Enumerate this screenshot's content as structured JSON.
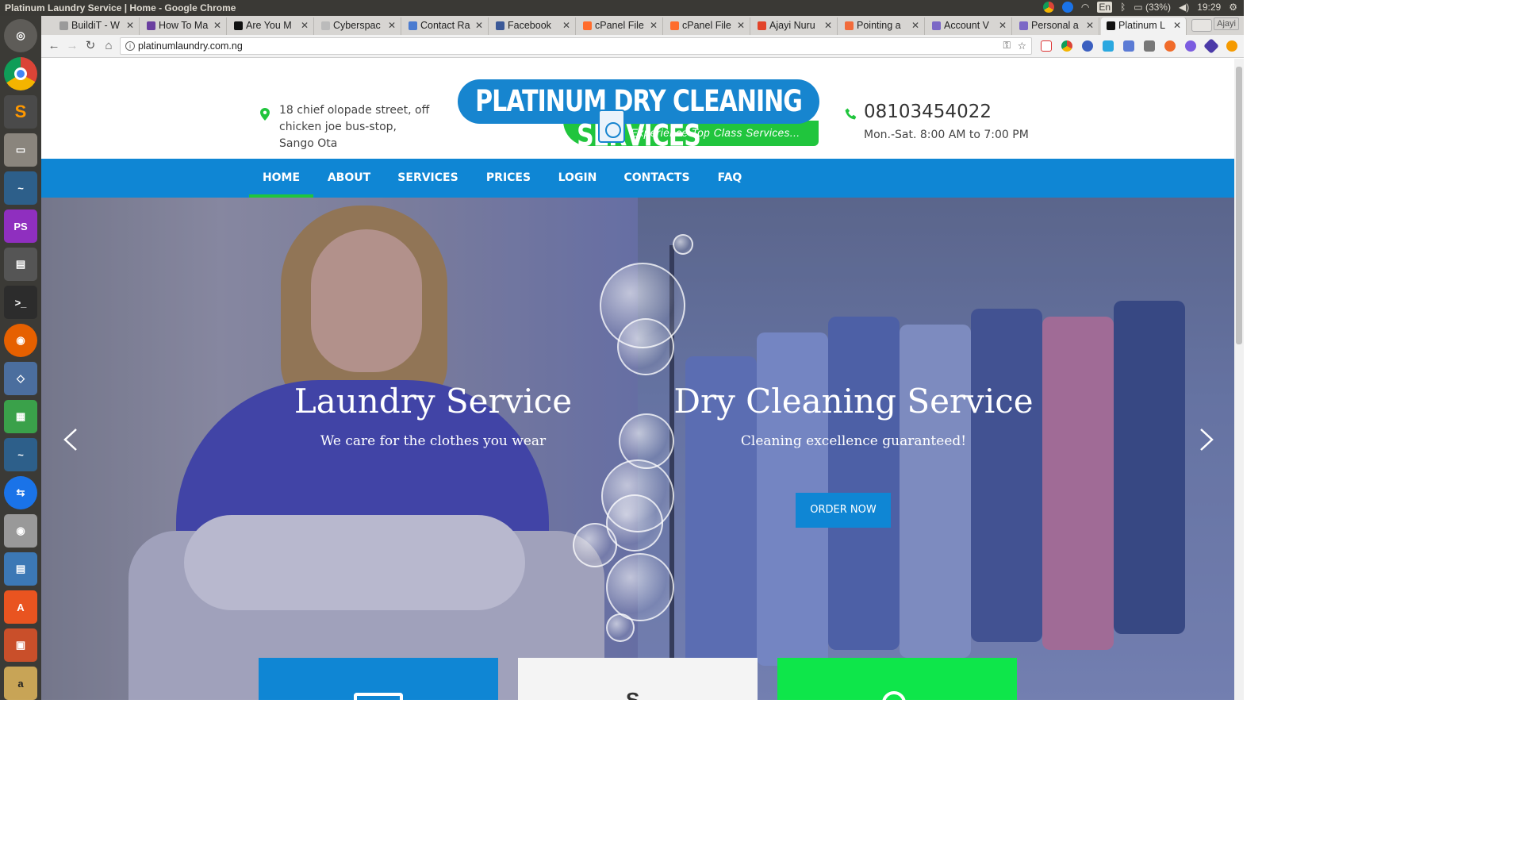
{
  "os": {
    "window_title": "Platinum Laundry Service | Home - Google Chrome",
    "battery": "(33%)",
    "clock": "19:29",
    "keyboard": "En"
  },
  "tabs": [
    {
      "label": "BuildiT - W",
      "fav": "#9a9a9a"
    },
    {
      "label": "How To Ma",
      "fav": "#6a3fa0"
    },
    {
      "label": "Are You M",
      "fav": "#111111"
    },
    {
      "label": "Cyberspac",
      "fav": "#bbbbbb"
    },
    {
      "label": "Contact Ra",
      "fav": "#4a7bd0"
    },
    {
      "label": "Facebook",
      "fav": "#3b5998"
    },
    {
      "label": "cPanel File",
      "fav": "#ff6c2c"
    },
    {
      "label": "cPanel File",
      "fav": "#ff6c2c"
    },
    {
      "label": "Ajayi Nuru",
      "fav": "#e24329"
    },
    {
      "label": "Pointing a",
      "fav": "#f26b3a"
    },
    {
      "label": "Account V",
      "fav": "#7b68c6"
    },
    {
      "label": "Personal a",
      "fav": "#7b68c6"
    },
    {
      "label": "Platinum L",
      "fav": "#111111"
    }
  ],
  "browser": {
    "url": "platinumlaundry.com.ng",
    "profile": "Ajayi"
  },
  "site": {
    "address": "18 chief olopade street, off chicken joe bus-stop, Sango Ota",
    "logo_name": "PLATINUM DRY CLEANING SERVICES",
    "logo_tagline": "Experience Top Class Services...",
    "phone": "08103454022",
    "hours": "Mon.-Sat. 8:00 AM to 7:00 PM",
    "nav": [
      "HOME",
      "ABOUT",
      "SERVICES",
      "PRICES",
      "LOGIN",
      "CONTACTS",
      "FAQ"
    ],
    "colors": {
      "brand_blue": "#0f86d4",
      "brand_green": "#20c53d"
    }
  },
  "hero": {
    "slide1_title": "Laundry Service",
    "slide1_sub": "We care for the clothes you wear",
    "slide2_title": "Dry Cleaning Service",
    "slide2_sub": "Cleaning excellence guaranteed!",
    "order_button": "ORDER NOW"
  },
  "features": [
    {
      "color": "#0f86d4"
    },
    {
      "color": "#f4f4f4"
    },
    {
      "color": "#0ee64a"
    }
  ]
}
